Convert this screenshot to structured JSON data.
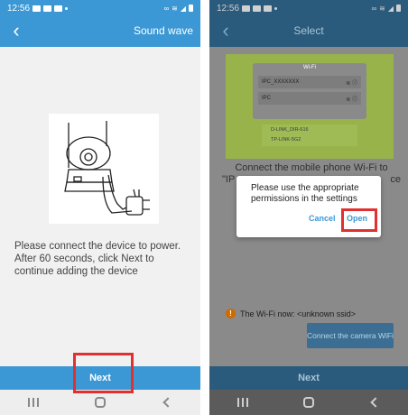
{
  "left": {
    "status_time": "12:56",
    "title": "Sound wave",
    "instructions": "Please connect the device to power. After 60 seconds, click Next to continue adding the device",
    "next_label": "Next"
  },
  "right": {
    "status_time": "12:56",
    "title": "Select",
    "wifi_image": {
      "header": "Wi-Fi",
      "network1": "IPC_XXXXXXX",
      "network2": "IPC",
      "network3": "D-LINK_DIR-616",
      "network4": "TP-LINK-5G2"
    },
    "instr_line1": "Connect the mobile phone Wi-Fi to",
    "instr_line2_left": "\"IP",
    "instr_line2_right": "ce",
    "dialog": {
      "message": "Please use the appropriate permissions in the settings",
      "cancel_label": "Cancel",
      "open_label": "Open"
    },
    "wifi_status": "The Wi-Fi now: <unknown ssid>",
    "connect_label": "Connect the camera WiFi",
    "next_label": "Next"
  },
  "colors": {
    "primary": "#3b98d5",
    "highlight": "#e03030"
  }
}
